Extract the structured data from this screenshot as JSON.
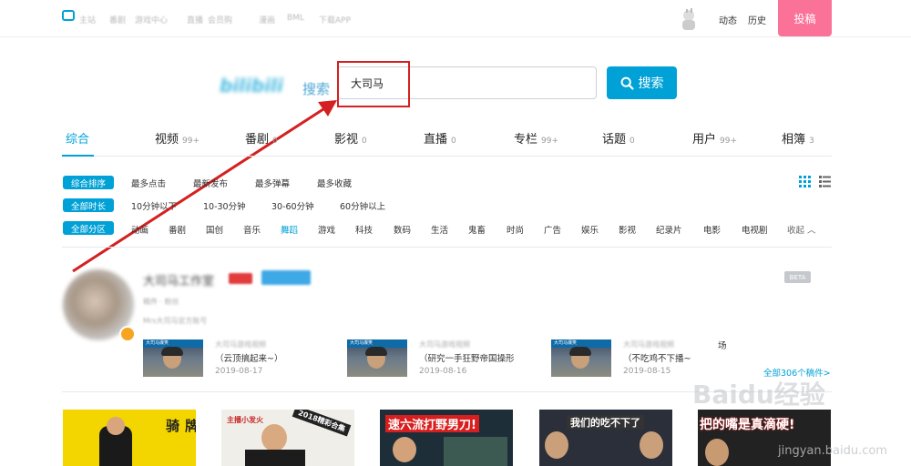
{
  "topnav": {
    "items": [
      "主站",
      "番剧",
      "游戏中心",
      "直播",
      "会员购",
      "漫画",
      "BML",
      "下载APP"
    ],
    "links": [
      "动态",
      "历史"
    ],
    "upload_label": "投稿"
  },
  "search": {
    "logo_text": "bilibili",
    "logo_suffix": "搜索",
    "query": "大司马",
    "button_label": "搜索"
  },
  "tabs": [
    {
      "label": "综合",
      "count": ""
    },
    {
      "label": "视频",
      "count": "99+"
    },
    {
      "label": "番剧",
      "count": "0"
    },
    {
      "label": "影视",
      "count": "0"
    },
    {
      "label": "直播",
      "count": "0"
    },
    {
      "label": "专栏",
      "count": "99+"
    },
    {
      "label": "话题",
      "count": "0"
    },
    {
      "label": "用户",
      "count": "99+"
    },
    {
      "label": "相簿",
      "count": "3"
    }
  ],
  "filters": {
    "sort": {
      "badge": "综合排序",
      "options": [
        "最多点击",
        "最新发布",
        "最多弹幕",
        "最多收藏"
      ]
    },
    "duration": {
      "badge": "全部时长",
      "options": [
        "10分钟以下",
        "10-30分钟",
        "30-60分钟",
        "60分钟以上"
      ]
    },
    "zone": {
      "badge": "全部分区",
      "options": [
        "动画",
        "番剧",
        "国创",
        "音乐",
        "舞蹈",
        "游戏",
        "科技",
        "数码",
        "生活",
        "鬼畜",
        "时尚",
        "广告",
        "娱乐",
        "影视",
        "纪录片",
        "电影",
        "电视剧"
      ],
      "collapse_label": "收起"
    }
  },
  "user": {
    "name": "大司马工作室",
    "stats": "稿件 · 粉丝",
    "sign": "Mrs大司马官方账号",
    "beta": "BETA",
    "videos": [
      {
        "title_top": "大司马游戏视频",
        "title": "（云顶搞起来~）",
        "date": "2019-08-17",
        "thumb_bar": "大司马爆笑"
      },
      {
        "title_top": "大司马游戏视频",
        "title": "（研究一手狂野帝国操形",
        "date": "2019-08-16",
        "thumb_bar": "大司马爆笑"
      },
      {
        "title_top": "大司马游戏视频",
        "title_suffix": "场",
        "title": "（不吃鸡不下播~",
        "date": "2019-08-15",
        "thumb_bar": "大司马爆笑"
      }
    ],
    "more_label": "全部306个稿件>"
  },
  "results": [
    {
      "caption": "牌 骑",
      "note": ""
    },
    {
      "caption": "2018精彩合集",
      "note": "主播小发火"
    },
    {
      "caption": "速六流打野男刀!",
      "note": ""
    },
    {
      "caption": "我们的吃不下了",
      "note": ""
    },
    {
      "caption": "把的嘴是真滴硬!",
      "note": ""
    }
  ],
  "watermark": {
    "text": "Baidu经验",
    "sub": "jingyan.baidu.com"
  },
  "colors": {
    "accent": "#00a1d6",
    "pink": "#fb7299",
    "annotation": "#d42020"
  }
}
